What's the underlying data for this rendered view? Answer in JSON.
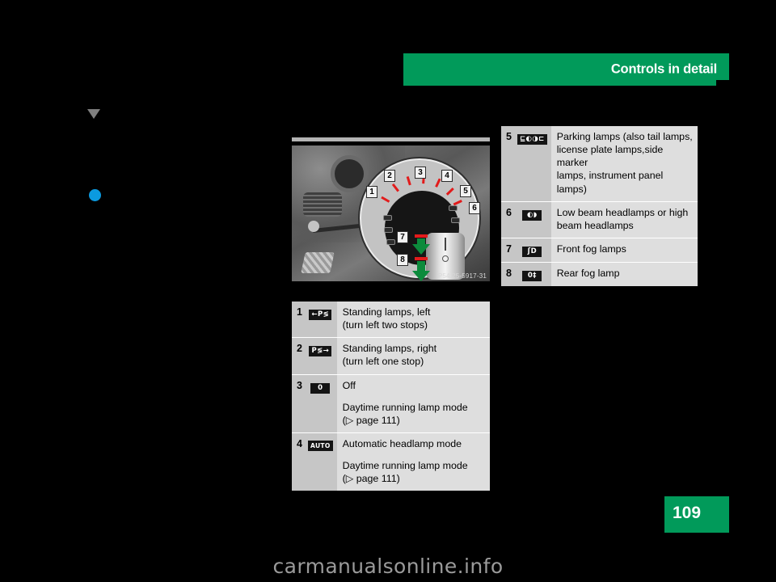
{
  "header": {
    "title": "Controls in detail",
    "accent_color": "#019a5a"
  },
  "page_number": "109",
  "watermark": "carmanualsonline.info",
  "figure": {
    "caption": "P54.25-5917-31",
    "callouts": [
      "1",
      "2",
      "3",
      "4",
      "5",
      "6",
      "7",
      "8"
    ]
  },
  "markers": {
    "triangle_color": "#7f7f7f",
    "dot_color": "#0b9ae0"
  },
  "table_top": {
    "rows": [
      {
        "num": "5",
        "icon": "parking-lamps-symbol",
        "icon_glyph": "⊑◐◑⊏",
        "lines": [
          "Parking lamps (also tail lamps,",
          "license plate lamps,side marker",
          "lamps, instrument panel lamps)"
        ]
      },
      {
        "num": "6",
        "icon": "low-beam-headlamp-symbol",
        "icon_glyph": "◐◗",
        "lines": [
          "Low beam headlamps or high",
          "beam headlamps"
        ]
      },
      {
        "num": "7",
        "icon": "front-fog-lamp-symbol",
        "icon_glyph": "ʃD",
        "lines": [
          "Front fog lamps"
        ]
      },
      {
        "num": "8",
        "icon": "rear-fog-lamp-symbol",
        "icon_glyph": "0‡",
        "lines": [
          "Rear fog lamp"
        ]
      }
    ]
  },
  "table_bottom": {
    "rows": [
      {
        "num": "1",
        "icon": "standing-lamps-left-symbol",
        "icon_glyph": "←P≶",
        "lines": [
          "Standing lamps, left",
          "(turn left two stops)"
        ],
        "extra": []
      },
      {
        "num": "2",
        "icon": "standing-lamps-right-symbol",
        "icon_glyph": "P≶→",
        "lines": [
          "Standing lamps, right",
          "(turn left one stop)"
        ],
        "extra": []
      },
      {
        "num": "3",
        "icon": "off-symbol",
        "icon_glyph": "0",
        "lines": [
          "Off"
        ],
        "extra": [
          "Daytime running lamp mode",
          "(▷ page 111)"
        ]
      },
      {
        "num": "4",
        "icon": "automatic-headlamp-symbol",
        "icon_glyph": "AUTO",
        "lines": [
          "Automatic headlamp mode"
        ],
        "extra": [
          "Daytime running lamp mode",
          "(▷ page 111)"
        ]
      }
    ]
  }
}
